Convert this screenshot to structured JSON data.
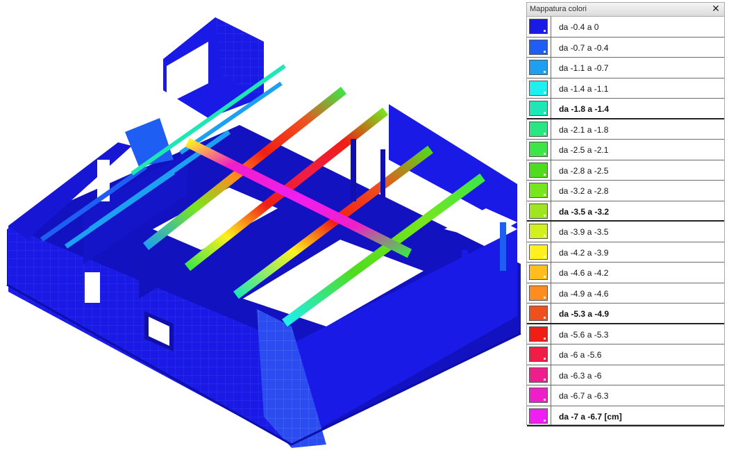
{
  "legend": {
    "title": "Mappatura colori",
    "close_icon": "close-icon",
    "entries": [
      {
        "label": "da -0.4 a 0",
        "color": "#1a1ae6",
        "bold": false
      },
      {
        "label": "da -0.7 a -0.4",
        "color": "#1e5ef2",
        "bold": false
      },
      {
        "label": "da -1.1 a -0.7",
        "color": "#1ea0f2",
        "bold": false
      },
      {
        "label": "da -1.4 a -1.1",
        "color": "#1ef0f0",
        "bold": false
      },
      {
        "label": "da -1.8 a -1.4",
        "color": "#1ee6b4",
        "bold": true
      },
      {
        "label": "da -2.1 a -1.8",
        "color": "#28e682",
        "bold": false
      },
      {
        "label": "da -2.5 a -2.1",
        "color": "#3ce646",
        "bold": false
      },
      {
        "label": "da -2.8 a -2.5",
        "color": "#50dc1e",
        "bold": false
      },
      {
        "label": "da -3.2 a -2.8",
        "color": "#78e61e",
        "bold": false
      },
      {
        "label": "da -3.5 a -3.2",
        "color": "#a0e61e",
        "bold": true
      },
      {
        "label": "da -3.9 a -3.5",
        "color": "#d2f01e",
        "bold": false
      },
      {
        "label": "da -4.2 a -3.9",
        "color": "#fff01e",
        "bold": false
      },
      {
        "label": "da -4.6 a -4.2",
        "color": "#ffbe1e",
        "bold": false
      },
      {
        "label": "da -4.9 a -4.6",
        "color": "#ff8c1e",
        "bold": false
      },
      {
        "label": "da -5.3 a -4.9",
        "color": "#f0501e",
        "bold": true
      },
      {
        "label": "da -5.6 a -5.3",
        "color": "#f01e14",
        "bold": false
      },
      {
        "label": "da -6 a -5.6",
        "color": "#f01e46",
        "bold": false
      },
      {
        "label": "da -6.3 a -6",
        "color": "#f01e8c",
        "bold": false
      },
      {
        "label": "da -6.7 a -6.3",
        "color": "#f01ec8",
        "bold": false
      },
      {
        "label": "da -7 a -6.7  [cm]",
        "color": "#f01ef0",
        "bold": true
      }
    ]
  },
  "model": {
    "base_color": "#1a1ae6",
    "edge_color": "#0e0ea8",
    "shade_color": "#1414c8"
  }
}
